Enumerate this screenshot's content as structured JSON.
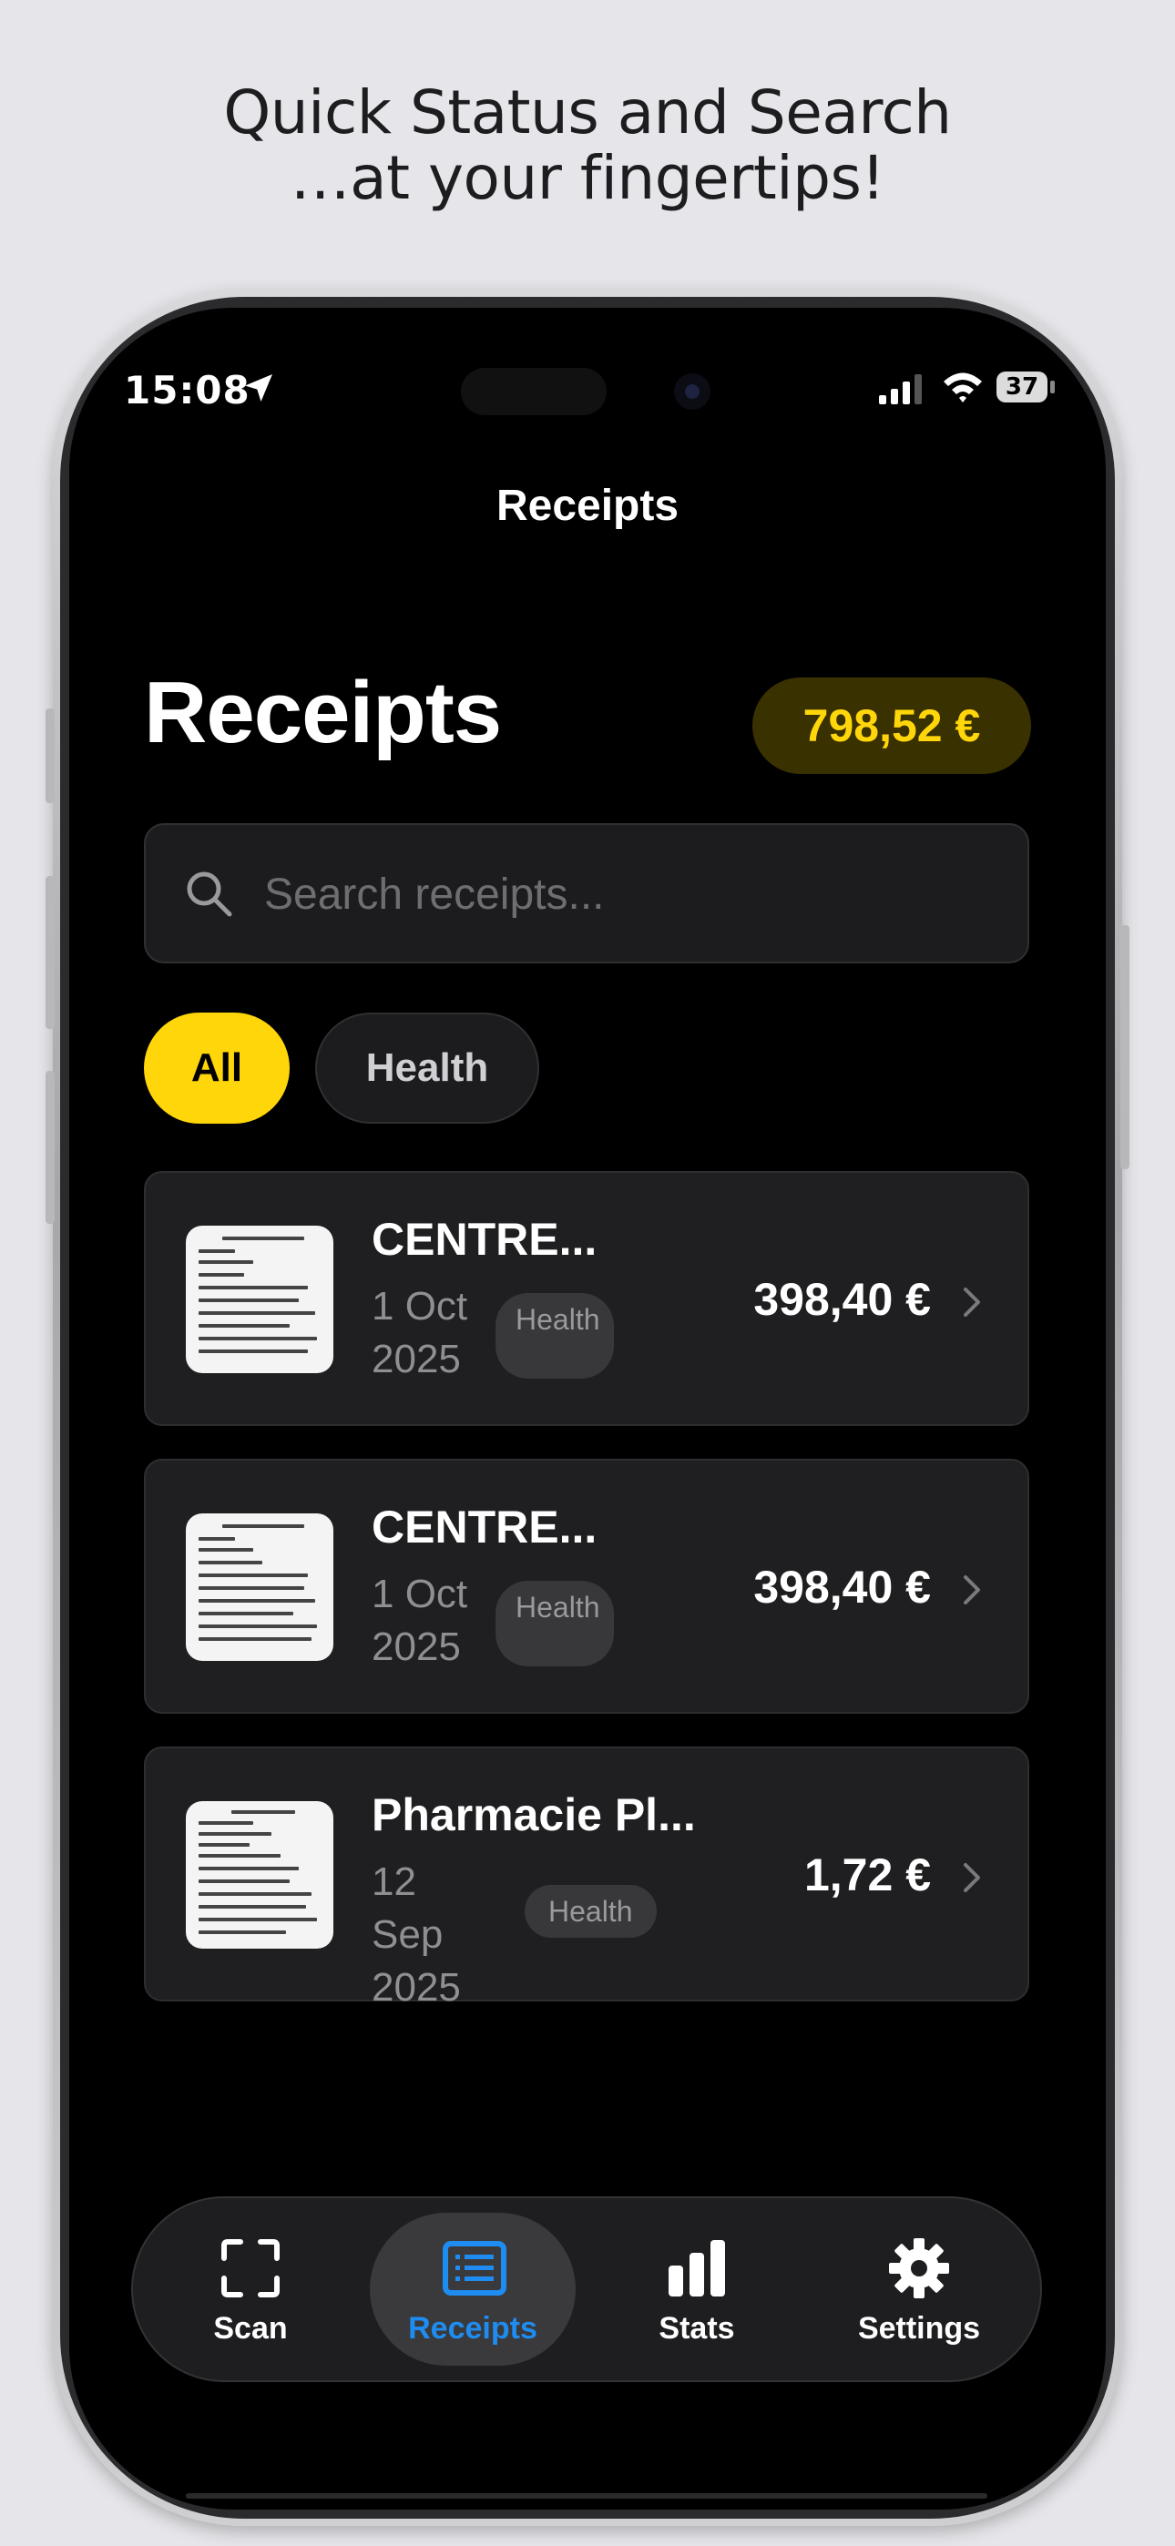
{
  "headline": {
    "line1": "Quick Status and Search",
    "line2": "…at your fingertips!"
  },
  "status_bar": {
    "time": "15:08",
    "battery": "37",
    "icons": [
      "location-arrow-icon",
      "signal-icon",
      "wifi-icon",
      "battery-icon"
    ]
  },
  "nav": {
    "title": "Receipts"
  },
  "header": {
    "title": "Receipts",
    "total": "798,52 €"
  },
  "search": {
    "placeholder": "Search receipts...",
    "value": "",
    "icon": "search-icon"
  },
  "filters": [
    {
      "label": "All",
      "selected": true
    },
    {
      "label": "Health",
      "selected": false
    }
  ],
  "receipts": [
    {
      "merchant": "CENTRE...",
      "date": "1 Oct 2025",
      "tag": "Health",
      "amount": "398,40 €"
    },
    {
      "merchant": "CENTRE...",
      "date": "1 Oct 2025",
      "tag": "Health",
      "amount": "398,40 €"
    },
    {
      "merchant": "Pharmacie Pl...",
      "date": "12 Sep 2025",
      "tag": "Health",
      "amount": "1,72 €"
    }
  ],
  "tabbar": {
    "tabs": [
      {
        "label": "Scan",
        "icon": "scan-icon"
      },
      {
        "label": "Receipts",
        "icon": "receipts-list-icon",
        "active": true
      },
      {
        "label": "Stats",
        "icon": "bar-chart-icon"
      },
      {
        "label": "Settings",
        "icon": "gear-icon"
      }
    ]
  },
  "colors": {
    "accent": "#ffd60a",
    "total_pill_bg": "#3a3100",
    "active_tab": "#1e8cf0",
    "background": "#000000",
    "card": "#1f1f21"
  }
}
